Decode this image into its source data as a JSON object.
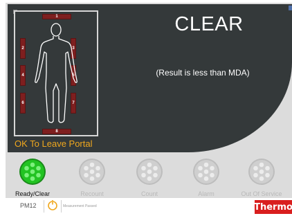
{
  "detectors": [
    {
      "number": "1"
    },
    {
      "number": "2"
    },
    {
      "number": "3"
    },
    {
      "number": "4"
    },
    {
      "number": "5"
    },
    {
      "number": "6"
    },
    {
      "number": "7"
    },
    {
      "number": "8"
    }
  ],
  "result": {
    "title": "CLEAR",
    "note": "(Result is less than MDA)"
  },
  "portal_message": "OK To Leave Portal",
  "statuses": [
    {
      "label": "Ready/Clear",
      "icon": "status-lamp-icon",
      "active": true
    },
    {
      "label": "Recount",
      "icon": "status-lamp-icon",
      "active": false
    },
    {
      "label": "Count",
      "icon": "status-lamp-icon",
      "active": false
    },
    {
      "label": "Alarm",
      "icon": "status-lamp-icon",
      "active": false
    },
    {
      "label": "Out Of Service",
      "icon": "status-lamp-icon",
      "active": false
    }
  ],
  "footer": {
    "monitor_id": "PM12",
    "measurement_status": "Measurement Passed",
    "brand": "Thermo"
  },
  "colors": {
    "panel": "#34393a",
    "detector": "#7e1f1f",
    "active_lamp": "#22c322",
    "inactive_lamp": "#c8c8c8",
    "message": "#f0a81e",
    "brand": "#d91e1e"
  }
}
